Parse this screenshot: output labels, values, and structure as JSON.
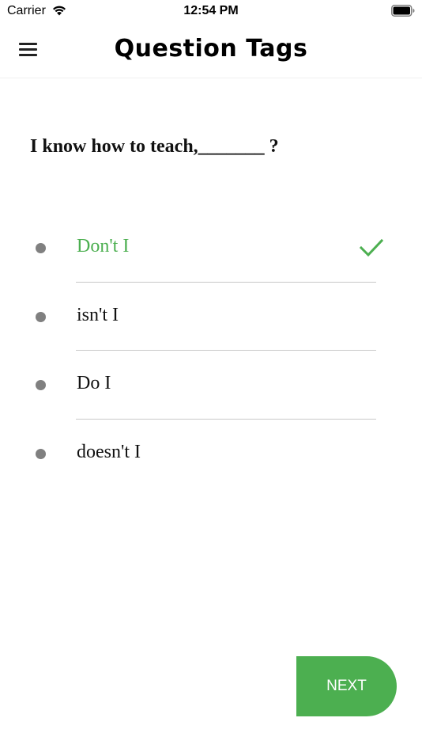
{
  "status_bar": {
    "carrier": "Carrier",
    "time": "12:54 PM"
  },
  "header": {
    "title": "Question Tags",
    "menu_icon": "hamburger-menu-icon"
  },
  "question": {
    "text": "I know how to teach,_______ ?"
  },
  "options": [
    {
      "label": "Don't I",
      "correct": true
    },
    {
      "label": "isn't I",
      "correct": false
    },
    {
      "label": "Do I",
      "correct": false
    },
    {
      "label": "doesn't I",
      "correct": false
    }
  ],
  "next_button": {
    "label": "NEXT"
  },
  "colors": {
    "accent": "#4caf50",
    "bullet": "#808080",
    "divider": "#c8c8c8"
  }
}
